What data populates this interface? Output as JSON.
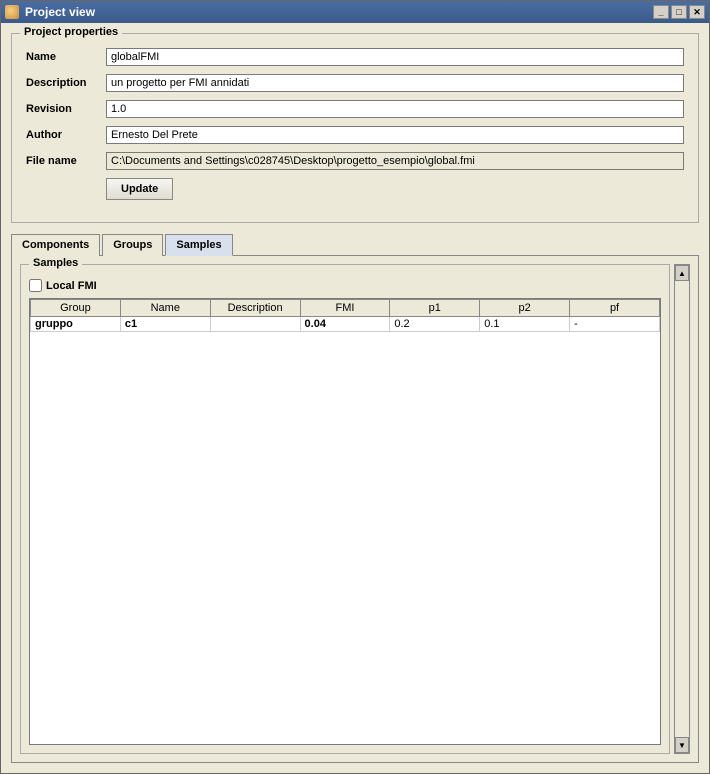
{
  "window": {
    "title": "Project view"
  },
  "project": {
    "legend": "Project properties",
    "labels": {
      "name": "Name",
      "description": "Description",
      "revision": "Revision",
      "author": "Author",
      "filename": "File name"
    },
    "values": {
      "name": "globalFMI",
      "description": "un progetto per FMI annidati",
      "revision": "1.0",
      "author": "Ernesto Del Prete",
      "filename": "C:\\Documents and Settings\\c028745\\Desktop\\progetto_esempio\\global.fmi"
    },
    "update_label": "Update"
  },
  "tabs": {
    "components": "Components",
    "groups": "Groups",
    "samples": "Samples"
  },
  "samples": {
    "legend": "Samples",
    "local_fmi_label": "Local FMI",
    "local_fmi_checked": false,
    "columns": [
      "Group",
      "Name",
      "Description",
      "FMI",
      "p1",
      "p2",
      "pf"
    ],
    "rows": [
      {
        "group": "gruppo",
        "name": "c1",
        "description": "",
        "fmi": "0.04",
        "p1": "0.2",
        "p2": "0.1",
        "pf": "-"
      }
    ]
  }
}
